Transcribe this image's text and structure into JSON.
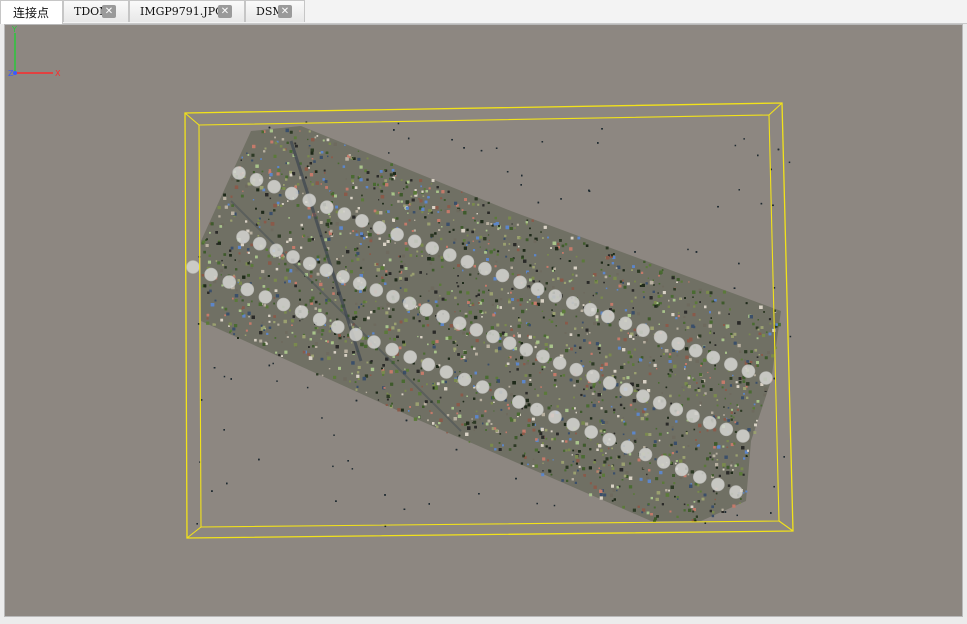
{
  "tabs": [
    {
      "label": "连接点",
      "active": true,
      "closable": false
    },
    {
      "label": "TDOM",
      "active": false,
      "closable": true
    },
    {
      "label": "IMGP9791.JPG",
      "active": false,
      "closable": true
    },
    {
      "label": "DSM",
      "active": false,
      "closable": true
    }
  ],
  "tab_close_glyph": "✕",
  "viewport": {
    "background_color": "#8d8781",
    "bounding_box_color": "#f2e21a",
    "content": "point cloud of tie points with camera positions",
    "axis_labels": {
      "x": "X",
      "y": "Y",
      "z": "Z"
    },
    "axis_colors": {
      "x": "#ff2a2a",
      "y": "#2ac83a",
      "z": "#3a5aff"
    }
  }
}
